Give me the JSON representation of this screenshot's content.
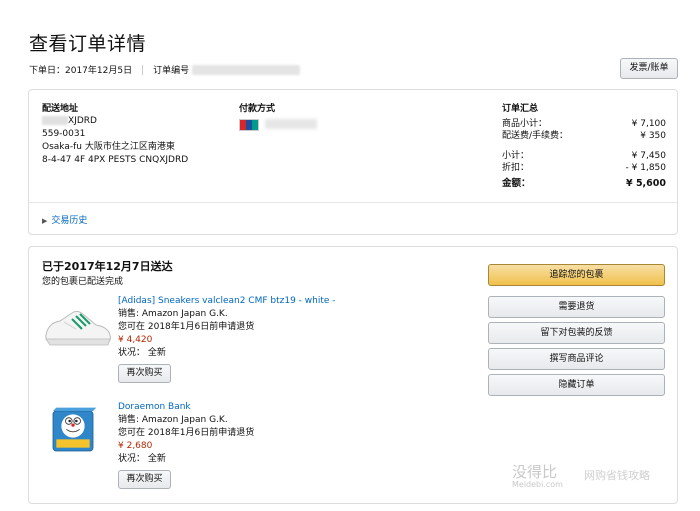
{
  "page": {
    "title": "查看订单详情",
    "order_date": "下单日：2017年12月5日",
    "order_number_label": "订单编号",
    "invoice_button": "发票/账单"
  },
  "shipping": {
    "label": "配送地址",
    "line1_suffix": "XJDRD",
    "line2": "559-0031",
    "line3": "Osaka-fu 大阪市住之江区南港東",
    "line4": "8-4-47 4F 4PX PESTS CNQXJDRD"
  },
  "payment": {
    "label": "付款方式"
  },
  "summary": {
    "label": "订单汇总",
    "rows": [
      {
        "label": "商品小计：",
        "value": "¥ 7,100"
      },
      {
        "label": "配送费/手续费：",
        "value": "¥ 350"
      },
      {
        "label": "小计：",
        "value": "¥ 7,450"
      },
      {
        "label": "折扣：",
        "value": "- ¥ 1,850"
      },
      {
        "label": "金额：",
        "value": "¥ 5,600"
      }
    ]
  },
  "history_link": "交易历史",
  "delivery": {
    "status": "已于2017年12月7日送达",
    "sub": "您的包裹已配送完成"
  },
  "items": [
    {
      "title": "[Adidas] Sneakers valclean2 CMF btz19 - white -",
      "seller": "销售: Amazon Japan G.K.",
      "return_note": "您可在 2018年1月6日前申请退货",
      "price": "¥ 4,420",
      "condition": "状况： 全新",
      "rebuy": "再次购买"
    },
    {
      "title": "Doraemon Bank",
      "seller": "销售: Amazon Japan G.K.",
      "return_note": "您可在 2018年1月6日前申请退货",
      "price": "¥ 2,680",
      "condition": "状况： 全新",
      "rebuy": "再次购买"
    }
  ],
  "actions": {
    "track": "追踪您的包裹",
    "return": "需要退货",
    "feedback": "留下对包装的反馈",
    "review": "撰写商品评论",
    "hide": "隐藏订单"
  },
  "watermark": {
    "brand": "没得比",
    "domain": "Meidebi.com",
    "tagline": "网购省钱攻略"
  },
  "colors": {
    "link": "#0066c0",
    "price": "#b12704",
    "primary_button": "#f0c14b"
  }
}
